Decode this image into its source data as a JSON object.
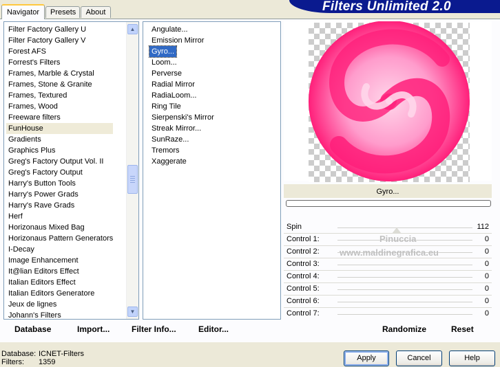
{
  "tabs": [
    {
      "label": "Navigator",
      "active": true
    },
    {
      "label": "Presets",
      "active": false
    },
    {
      "label": "About",
      "active": false
    }
  ],
  "app_title": "Filters Unlimited 2.0",
  "categories": {
    "items": [
      "Filter Factory Gallery U",
      "Filter Factory Gallery V",
      "Forest AFS",
      "Forrest's Filters",
      "Frames, Marble & Crystal",
      "Frames, Stone & Granite",
      "Frames, Textured",
      "Frames, Wood",
      "Freeware filters",
      "FunHouse",
      "Gradients",
      "Graphics Plus",
      "Greg's Factory Output Vol. II",
      "Greg's Factory Output",
      "Harry's Button Tools",
      "Harry's Power Grads",
      "Harry's Rave Grads",
      "Herf",
      "Horizonaus Mixed Bag",
      "Horizonaus Pattern Generators",
      "I-Decay",
      "Image Enhancement",
      "It@lian Editors Effect",
      "Italian Editors Effect",
      "Italian Editors Generatore",
      "Jeux de lignes",
      "Johann's Filters"
    ],
    "selected": "FunHouse"
  },
  "filters": {
    "items": [
      "Angulate...",
      "Emission Mirror",
      "Gyro...",
      "Loom...",
      "Perverse",
      "Radial Mirror",
      "RadiaLoom...",
      "Ring Tile",
      "Sierpenski's Mirror",
      "Streak Mirror...",
      "SunRaze...",
      "Tremors",
      "Xaggerate"
    ],
    "selected": "Gyro..."
  },
  "preview": {
    "label": "Gyro...",
    "progress": 0,
    "colors": {
      "primary": "#ff1f7a",
      "light": "#ff9ccc",
      "pale": "#ffd6ea"
    }
  },
  "controls": [
    {
      "label": "Spin",
      "value": "112",
      "level": 0.44
    },
    {
      "label": "Control 1:",
      "value": "0",
      "level": 0
    },
    {
      "label": "Control 2:",
      "value": "0",
      "level": 0
    },
    {
      "label": "Control 3:",
      "value": "0",
      "level": 0
    },
    {
      "label": "Control 4:",
      "value": "0",
      "level": 0
    },
    {
      "label": "Control 5:",
      "value": "0",
      "level": 0
    },
    {
      "label": "Control 6:",
      "value": "0",
      "level": 0
    },
    {
      "label": "Control 7:",
      "value": "0",
      "level": 0
    }
  ],
  "watermark": {
    "line1": "Pinuccia",
    "line2": "www.maldinegrafica.eu"
  },
  "panel_buttons": {
    "database": "Database",
    "import": "Import...",
    "filter_info": "Filter Info...",
    "editor": "Editor...",
    "randomize": "Randomize",
    "reset": "Reset"
  },
  "footer": {
    "database_label": "Database:",
    "database_value": "ICNET-Filters",
    "filters_label": "Filters:",
    "filters_value": "1359"
  },
  "dialog_buttons": {
    "apply": "Apply",
    "cancel": "Cancel",
    "help": "Help"
  }
}
